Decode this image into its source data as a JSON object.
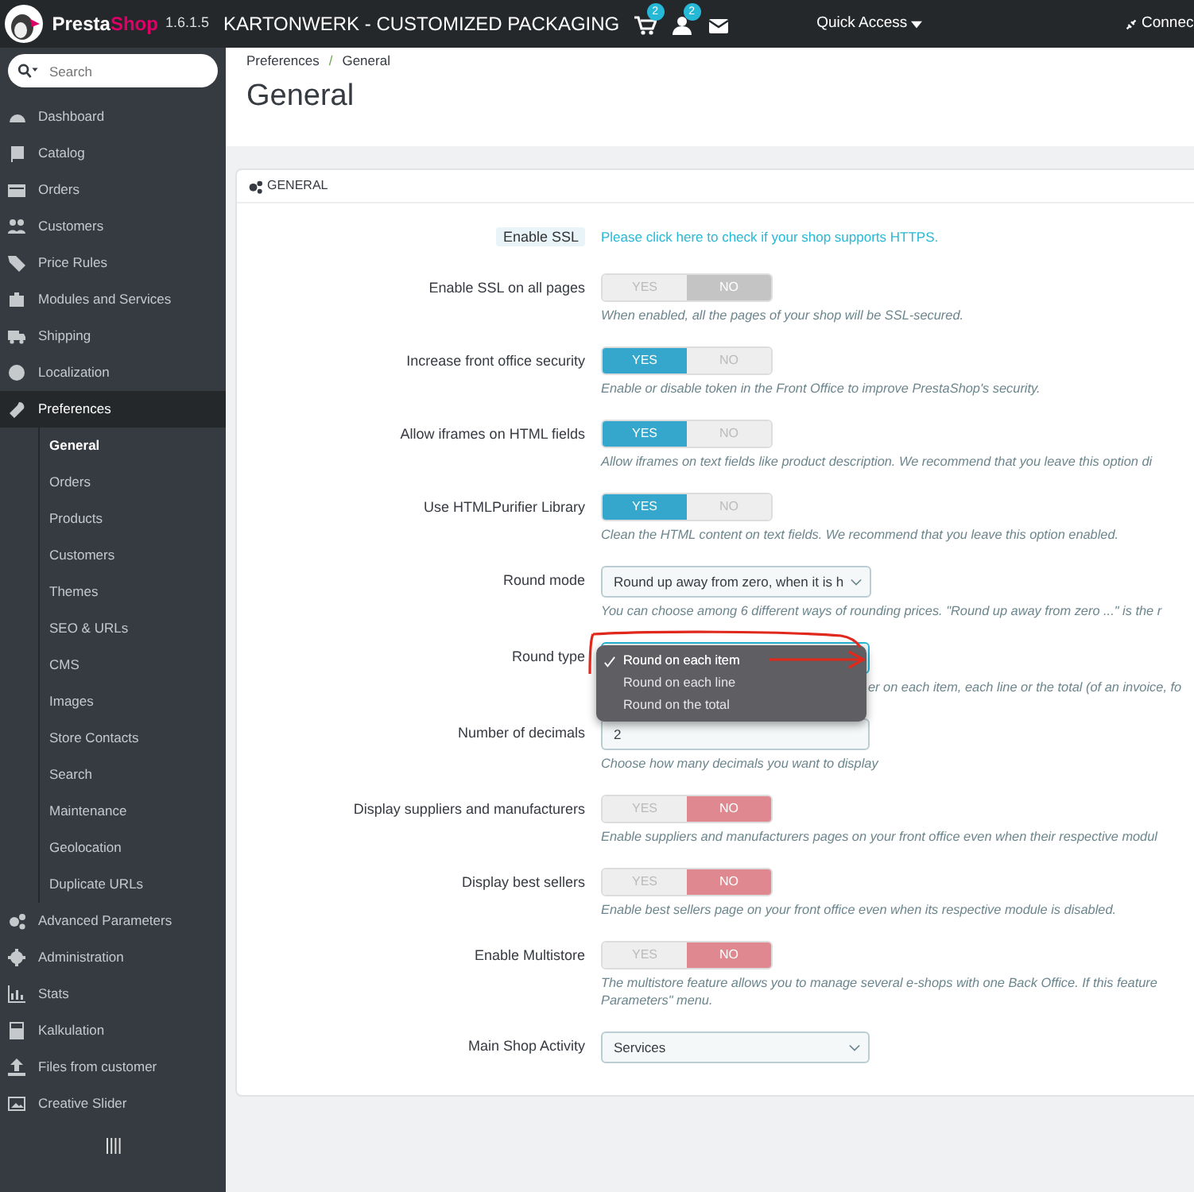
{
  "topbar": {
    "brand_part_1": "Presta",
    "brand_part_2": "Shop",
    "version": "1.6.1.5",
    "shop_name": "KARTONWERK - CUSTOMIZED PACKAGING",
    "notifications": [
      {
        "badge": "2"
      },
      {
        "badge": "2"
      }
    ],
    "quick_access": "Quick Access",
    "connect": "Connec"
  },
  "sidebar": {
    "search": {
      "placeholder": "Search"
    },
    "items": [
      {
        "label": "Dashboard",
        "selected": false
      },
      {
        "label": "Catalog",
        "selected": false
      },
      {
        "label": "Orders",
        "selected": false
      },
      {
        "label": "Customers",
        "selected": false
      },
      {
        "label": "Price Rules",
        "selected": false
      },
      {
        "label": "Modules and Services",
        "selected": false
      },
      {
        "label": "Shipping",
        "selected": false
      },
      {
        "label": "Localization",
        "selected": false
      },
      {
        "label": "Preferences",
        "selected": true,
        "children": [
          {
            "label": "General",
            "selected": true
          },
          {
            "label": "Orders",
            "selected": false
          },
          {
            "label": "Products",
            "selected": false
          },
          {
            "label": "Customers",
            "selected": false
          },
          {
            "label": "Themes",
            "selected": false
          },
          {
            "label": "SEO & URLs",
            "selected": false
          },
          {
            "label": "CMS",
            "selected": false
          },
          {
            "label": "Images",
            "selected": false
          },
          {
            "label": "Store Contacts",
            "selected": false
          },
          {
            "label": "Search",
            "selected": false
          },
          {
            "label": "Maintenance",
            "selected": false
          },
          {
            "label": "Geolocation",
            "selected": false
          },
          {
            "label": "Duplicate URLs",
            "selected": false
          }
        ]
      },
      {
        "label": "Advanced Parameters",
        "selected": false
      },
      {
        "label": "Administration",
        "selected": false
      },
      {
        "label": "Stats",
        "selected": false
      },
      {
        "label": "Kalkulation",
        "selected": false
      },
      {
        "label": "Files from customer",
        "selected": false
      },
      {
        "label": "Creative Slider",
        "selected": false
      }
    ]
  },
  "breadcrumb": {
    "separator": "/",
    "items": [
      "Preferences",
      "General"
    ]
  },
  "page_title": "General",
  "panel": {
    "title": "GENERAL",
    "rows": [
      {
        "kind": "link",
        "label": "Enable SSL",
        "link": "Please click here to check if your shop supports HTTPS."
      },
      {
        "kind": "switch",
        "label": "Enable SSL on all pages",
        "yes": "YES",
        "no": "NO",
        "on": false,
        "disabled": true,
        "help": "When enabled, all the pages of your shop will be SSL-secured."
      },
      {
        "kind": "switch",
        "label": "Increase front office security",
        "yes": "YES",
        "no": "NO",
        "on": true,
        "disabled": false,
        "help": "Enable or disable token in the Front Office to improve PrestaShop's security."
      },
      {
        "kind": "switch",
        "label": "Allow iframes on HTML fields",
        "yes": "YES",
        "no": "NO",
        "on": true,
        "disabled": false,
        "help": "Allow iframes on text fields like product description. We recommend that you leave this option di"
      },
      {
        "kind": "switch",
        "label": "Use HTMLPurifier Library",
        "yes": "YES",
        "no": "NO",
        "on": true,
        "disabled": false,
        "help": "Clean the HTML content on text fields. We recommend that you leave this option enabled."
      },
      {
        "kind": "select",
        "label": "Round mode",
        "value": "Round up away from zero, when it is h",
        "help": "You can choose among 6 different ways of rounding prices. \"Round up away from zero ...\" is the r"
      },
      {
        "kind": "open_select",
        "label": "Round type",
        "options": [
          {
            "label": "Round on each item",
            "selected": true
          },
          {
            "label": "Round on each line",
            "selected": false
          },
          {
            "label": "Round on the total",
            "selected": false
          }
        ],
        "help": "er on each item, each line or the total (of an invoice, fo"
      },
      {
        "kind": "text",
        "label": "Number of decimals",
        "value": "2",
        "help": "Choose how many decimals you want to display"
      },
      {
        "kind": "switch",
        "label": "Display suppliers and manufacturers",
        "yes": "YES",
        "no": "NO",
        "on": false,
        "disabled": false,
        "help": "Enable suppliers and manufacturers pages on your front office even when their respective modul"
      },
      {
        "kind": "switch",
        "label": "Display best sellers",
        "yes": "YES",
        "no": "NO",
        "on": false,
        "disabled": false,
        "help": "Enable best sellers page on your front office even when its respective module is disabled."
      },
      {
        "kind": "switch",
        "label": "Enable Multistore",
        "yes": "YES",
        "no": "NO",
        "on": false,
        "disabled": false,
        "help": "The multistore feature allows you to manage several e-shops with one Back Office. If this feature Parameters\" menu."
      },
      {
        "kind": "select",
        "label": "Main Shop Activity",
        "value": "Services"
      }
    ]
  }
}
